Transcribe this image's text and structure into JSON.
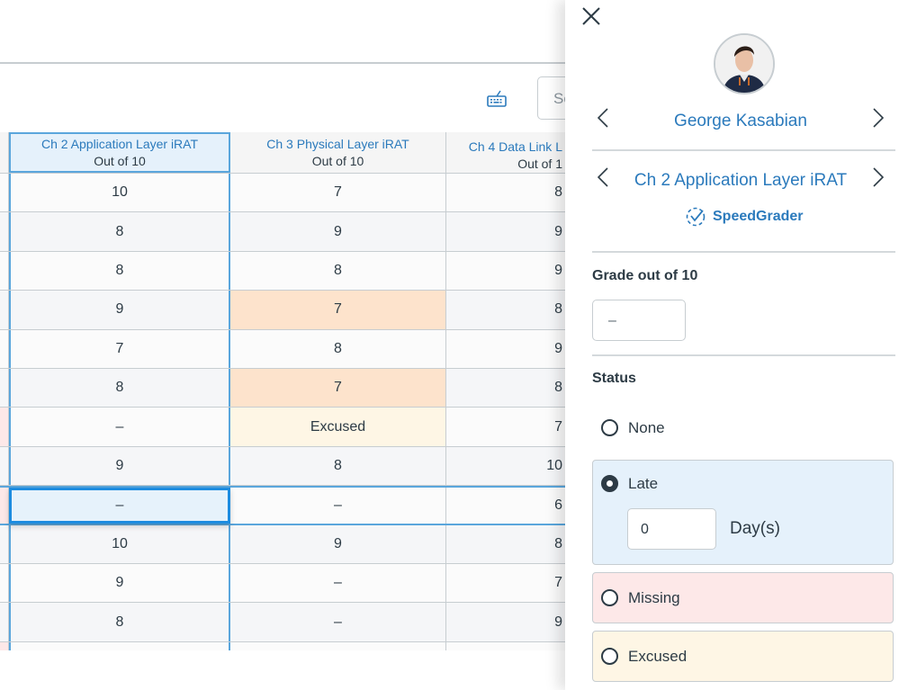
{
  "toolbar": {
    "keyboard_icon": "keyboard-icon",
    "search_placeholder": "Search"
  },
  "gradebook": {
    "columns": [
      {
        "title": "Ch 2 Application Layer iRAT",
        "subtitle": "Out of 10"
      },
      {
        "title": "Ch 3 Physical Layer iRAT",
        "subtitle": "Out of 10"
      },
      {
        "title": "Ch 4 Data Link L",
        "subtitle": "Out of 1"
      }
    ],
    "rows": [
      {
        "stub_status": "",
        "cells": [
          {
            "v": "10",
            "s": ""
          },
          {
            "v": "7",
            "s": ""
          },
          {
            "v": "8",
            "s": ""
          }
        ]
      },
      {
        "stub_status": "",
        "cells": [
          {
            "v": "8",
            "s": ""
          },
          {
            "v": "9",
            "s": ""
          },
          {
            "v": "9",
            "s": ""
          }
        ]
      },
      {
        "stub_status": "",
        "cells": [
          {
            "v": "8",
            "s": ""
          },
          {
            "v": "8",
            "s": ""
          },
          {
            "v": "9",
            "s": ""
          }
        ]
      },
      {
        "stub_status": "",
        "cells": [
          {
            "v": "9",
            "s": ""
          },
          {
            "v": "7",
            "s": "late"
          },
          {
            "v": "8",
            "s": ""
          }
        ]
      },
      {
        "stub_status": "",
        "cells": [
          {
            "v": "7",
            "s": ""
          },
          {
            "v": "8",
            "s": ""
          },
          {
            "v": "9",
            "s": ""
          }
        ]
      },
      {
        "stub_status": "",
        "cells": [
          {
            "v": "8",
            "s": ""
          },
          {
            "v": "7",
            "s": "late"
          },
          {
            "v": "8",
            "s": ""
          }
        ]
      },
      {
        "stub_status": "missing",
        "cells": [
          {
            "v": "–",
            "s": ""
          },
          {
            "v": "Excused",
            "s": "excused"
          },
          {
            "v": "7",
            "s": ""
          }
        ]
      },
      {
        "stub_status": "",
        "cells": [
          {
            "v": "9",
            "s": ""
          },
          {
            "v": "8",
            "s": ""
          },
          {
            "v": "10",
            "s": ""
          }
        ]
      },
      {
        "stub_status": "missing",
        "selected": true,
        "cells": [
          {
            "v": "–",
            "s": "active"
          },
          {
            "v": "–",
            "s": ""
          },
          {
            "v": "6",
            "s": ""
          }
        ]
      },
      {
        "stub_status": "",
        "cells": [
          {
            "v": "10",
            "s": ""
          },
          {
            "v": "9",
            "s": ""
          },
          {
            "v": "8",
            "s": ""
          }
        ]
      },
      {
        "stub_status": "",
        "cells": [
          {
            "v": "9",
            "s": ""
          },
          {
            "v": "–",
            "s": ""
          },
          {
            "v": "7",
            "s": ""
          }
        ]
      },
      {
        "stub_status": "",
        "cells": [
          {
            "v": "8",
            "s": ""
          },
          {
            "v": "–",
            "s": ""
          },
          {
            "v": "9",
            "s": ""
          }
        ]
      },
      {
        "stub_status": "missing",
        "cells": [
          {
            "v": "",
            "s": ""
          },
          {
            "v": "",
            "s": ""
          },
          {
            "v": "",
            "s": ""
          }
        ]
      }
    ]
  },
  "tray": {
    "close_icon": "close-icon",
    "student_name": "George Kasabian",
    "assignment_name": "Ch 2 Application Layer iRAT",
    "speedgrader_label": "SpeedGrader",
    "grade_label": "Grade out of 10",
    "grade_value": "–",
    "status_label": "Status",
    "status_options": [
      {
        "label": "None",
        "checked": false
      },
      {
        "label": "Late",
        "checked": true
      },
      {
        "label": "Missing",
        "checked": false
      },
      {
        "label": "Excused",
        "checked": false
      }
    ],
    "late_days_value": "0",
    "late_days_label": "Day(s)"
  },
  "colors": {
    "accent": "#2b7abc",
    "late": "#fde3cc",
    "missing": "#fde8e8",
    "excused": "#fef6e5",
    "selected": "#e5f1fb"
  }
}
